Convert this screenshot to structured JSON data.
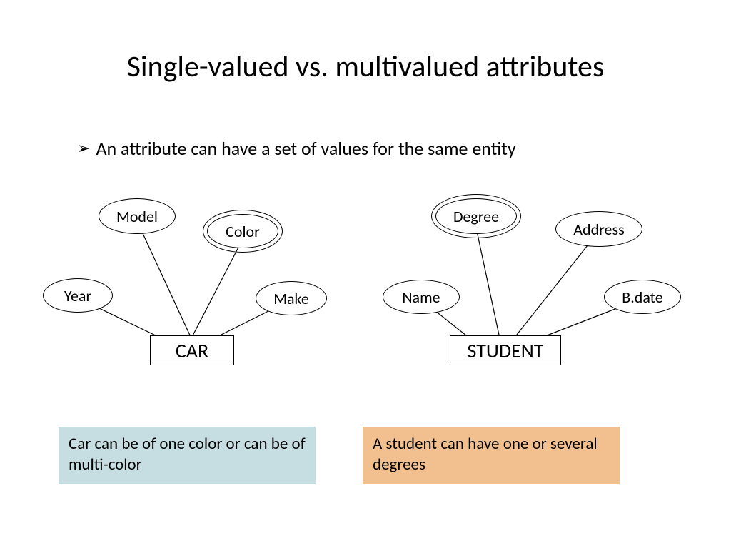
{
  "title": "Single-valued vs. multivalued attributes",
  "bullet": "An attribute can have a set of values for the same entity",
  "er": {
    "car": {
      "entity": "CAR",
      "attrs": {
        "model": "Model",
        "color": "Color",
        "year": "Year",
        "make": "Make"
      }
    },
    "student": {
      "entity": "STUDENT",
      "attrs": {
        "degree": "Degree",
        "address": "Address",
        "name": "Name",
        "bdate": "B.date"
      }
    }
  },
  "captions": {
    "car": "Car can be of one color or can be of multi-color",
    "student": "A student can have one or several degrees"
  }
}
